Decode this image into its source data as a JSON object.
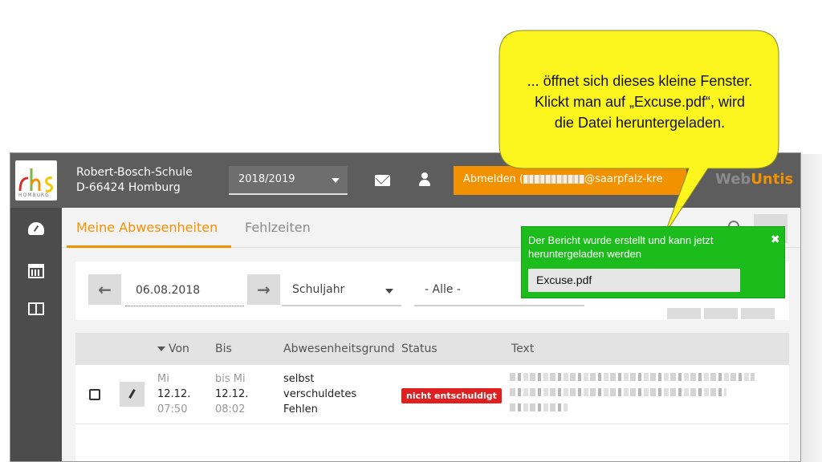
{
  "school": {
    "name": "Robert-Bosch-Schule",
    "address": "D-66424 Homburg",
    "logo_text": "HOMBURG"
  },
  "header": {
    "year_select": "2018/2019",
    "logout_prefix": "Abmelden (",
    "logout_suffix": "@saarpfalz-kre",
    "brand_prefix": "Web",
    "brand_suffix": "Untis"
  },
  "sidebar": {
    "items": [
      {
        "icon": "dashboard-icon"
      },
      {
        "icon": "calendar-icon"
      },
      {
        "icon": "book-icon"
      }
    ]
  },
  "tabs": {
    "active": "Meine Abwesenheiten",
    "second": "Fehlzeiten"
  },
  "filters": {
    "date": "06.08.2018",
    "period": "Schuljahr",
    "reason": "- Alle -"
  },
  "table": {
    "headers": [
      "Von",
      "Bis",
      "Abwesenheitsgrund",
      "Status",
      "Text"
    ],
    "rows": [
      {
        "von_day": "Mi",
        "von_date": "12.12.",
        "von_time": "07:50",
        "bis_day": "bis Mi",
        "bis_date": "12.12.",
        "bis_time": "08:02",
        "grund_1": "selbst",
        "grund_2": "verschuldetes",
        "grund_3": "Fehlen",
        "status": "nicht entschuldigt"
      }
    ]
  },
  "toast": {
    "message": "Der Bericht wurde erstellt und kann jetzt heruntergeladen werden",
    "close": "✖",
    "file": "Excuse.pdf"
  },
  "callout": {
    "line1": "... öffnet sich dieses kleine Fenster.",
    "line2": "Klickt man auf „Excuse.pdf“, wird",
    "line3": "die Datei heruntergeladen."
  },
  "colors": {
    "accent": "#f39200",
    "toast": "#1cbc1c",
    "callout": "#fdf51e",
    "status_red": "#e02020"
  }
}
